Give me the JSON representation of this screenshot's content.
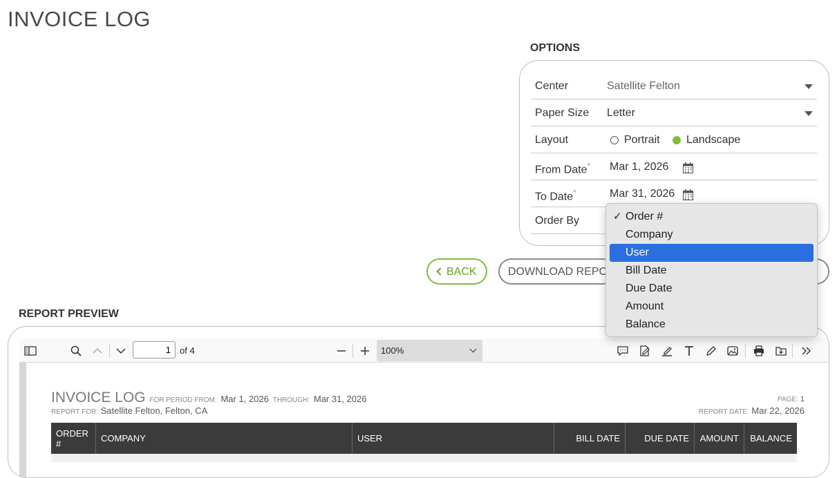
{
  "page": {
    "title": "INVOICE LOG"
  },
  "options": {
    "title": "OPTIONS",
    "center": {
      "label": "Center",
      "value": "Satellite Felton"
    },
    "paper_size": {
      "label": "Paper Size",
      "value": "Letter"
    },
    "layout": {
      "label": "Layout",
      "portrait": "Portrait",
      "landscape": "Landscape",
      "selected": "Landscape"
    },
    "from_date": {
      "label": "From Date",
      "required": "*",
      "value": "Mar 1, 2026"
    },
    "to_date": {
      "label": "To Date",
      "required": "*",
      "value": "Mar 31, 2026"
    },
    "order_by": {
      "label": "Order By"
    }
  },
  "order_by_dropdown": {
    "items": [
      "Order #",
      "Company",
      "User",
      "Bill Date",
      "Due Date",
      "Amount",
      "Balance"
    ],
    "checked": "Order #",
    "highlighted": "User",
    "check_mark": "✓"
  },
  "buttons": {
    "back": "BACK",
    "download": "DOWNLOAD REPORT"
  },
  "preview": {
    "title": "REPORT PREVIEW",
    "toolbar": {
      "page_current": "1",
      "page_of": "of 4",
      "zoom": "100%"
    },
    "document": {
      "title": "INVOICE LOG",
      "period_from_label": "FOR PERIOD FROM:",
      "period_from": "Mar 1, 2026",
      "through_label": "THROUGH:",
      "through": "Mar 31, 2026",
      "report_for_label": "REPORT FOR:",
      "report_for": "Satellite Felton, Felton, CA",
      "page_label": "PAGE:",
      "page": "1",
      "report_date_label": "REPORT DATE:",
      "report_date": "Mar 22, 2026",
      "columns": [
        "ORDER #",
        "COMPANY",
        "USER",
        "BILL DATE",
        "DUE DATE",
        "AMOUNT",
        "BALANCE"
      ]
    }
  },
  "colors": {
    "accent_green": "#7bbf3a",
    "highlight_blue": "#2a6fe0",
    "table_header": "#3b3b3b"
  }
}
